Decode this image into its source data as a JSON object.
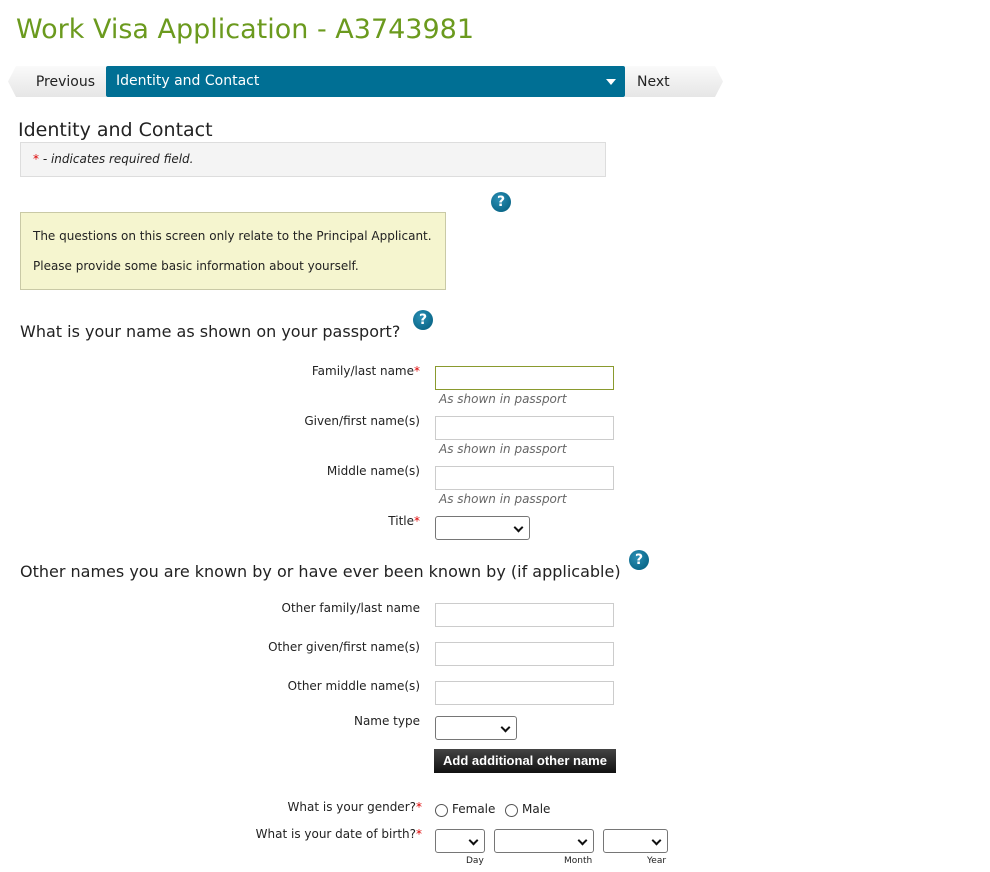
{
  "header": {
    "title": "Work Visa Application - A3743981"
  },
  "nav": {
    "previous": "Previous",
    "current": "Identity and Contact",
    "next": "Next"
  },
  "page": {
    "heading": "Identity and Contact",
    "required_star": "*",
    "required_note": "- indicates required field."
  },
  "info": {
    "line1": "The questions on this screen only relate to the Principal Applicant.",
    "line2": "Please provide some basic information about yourself."
  },
  "name_section": {
    "question": "What is your name as shown on your passport?",
    "family_label": "Family/last name",
    "given_label": "Given/first name(s)",
    "middle_label": "Middle name(s)",
    "title_label": "Title",
    "hint": "As shown in passport",
    "family_value": "",
    "given_value": "",
    "middle_value": "",
    "title_value": ""
  },
  "other_names": {
    "question": "Other names you are known by or have ever been known by (if applicable)",
    "family_label": "Other family/last name",
    "given_label": "Other given/first name(s)",
    "middle_label": "Other middle name(s)",
    "type_label": "Name type",
    "add_button": "Add additional other name"
  },
  "gender": {
    "label": "What is your gender?",
    "options": [
      "Female",
      "Male"
    ]
  },
  "dob": {
    "label": "What is your date of birth?",
    "day": "Day",
    "month": "Month",
    "year": "Year"
  },
  "help_icon": "?",
  "colors": {
    "accent": "#006f94",
    "title": "#6b9a1e",
    "required": "#dd0000"
  }
}
